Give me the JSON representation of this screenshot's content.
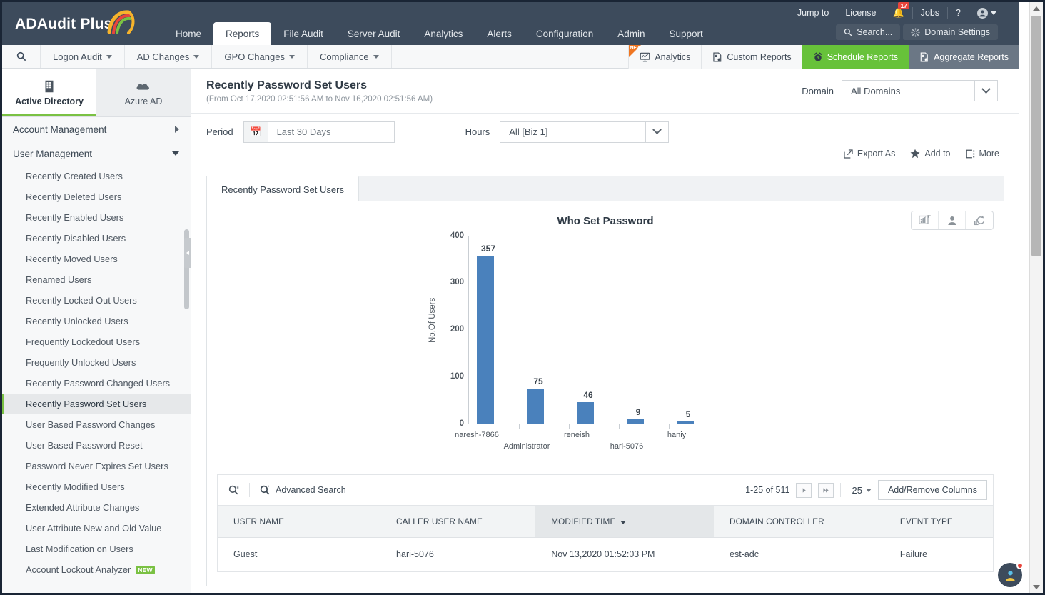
{
  "app": {
    "name": "ADAudit Plus",
    "logo_icon": "swirl-logo-icon"
  },
  "header": {
    "nav": [
      {
        "label": "Home",
        "active": false
      },
      {
        "label": "Reports",
        "active": true
      },
      {
        "label": "File Audit",
        "active": false
      },
      {
        "label": "Server Audit",
        "active": false
      },
      {
        "label": "Analytics",
        "active": false
      },
      {
        "label": "Alerts",
        "active": false
      },
      {
        "label": "Configuration",
        "active": false
      },
      {
        "label": "Admin",
        "active": false
      },
      {
        "label": "Support",
        "active": false
      }
    ],
    "utilities": [
      {
        "label": "Jump to",
        "icon": ""
      },
      {
        "label": "License",
        "icon": ""
      },
      {
        "label": "",
        "icon": "bell-icon",
        "badge": "17"
      },
      {
        "label": "Jobs",
        "icon": ""
      },
      {
        "label": "?",
        "icon": "help-icon"
      },
      {
        "label": "",
        "icon": "user-account-icon"
      }
    ],
    "search_label": "Search...",
    "search_icon": "search-icon",
    "domain_settings_label": "Domain Settings",
    "domain_settings_icon": "gear-icon"
  },
  "subnav": {
    "search_icon": "report-search-icon",
    "menus": [
      {
        "label": "Logon Audit"
      },
      {
        "label": "AD Changes"
      },
      {
        "label": "GPO Changes"
      },
      {
        "label": "Compliance"
      }
    ],
    "right": [
      {
        "label": "Analytics",
        "icon": "analytics-icon",
        "badge": "NEW",
        "style": "plain"
      },
      {
        "label": "Custom Reports",
        "icon": "custom-reports-icon",
        "style": "plain"
      },
      {
        "label": "Schedule Reports",
        "icon": "alarm-clock-icon",
        "style": "green"
      },
      {
        "label": "Aggregate Reports",
        "icon": "aggregate-reports-icon",
        "style": "grey"
      }
    ]
  },
  "sidebar": {
    "directory_tabs": [
      {
        "label": "Active Directory",
        "icon": "building-icon",
        "active": true
      },
      {
        "label": "Azure AD",
        "icon": "cloud-icon",
        "active": false
      }
    ],
    "groups": [
      {
        "label": "Account Management",
        "expanded": false
      },
      {
        "label": "User Management",
        "expanded": true
      }
    ],
    "items": [
      {
        "label": "Recently Created Users",
        "active": false
      },
      {
        "label": "Recently Deleted Users",
        "active": false
      },
      {
        "label": "Recently Enabled Users",
        "active": false
      },
      {
        "label": "Recently Disabled Users",
        "active": false
      },
      {
        "label": "Recently Moved Users",
        "active": false
      },
      {
        "label": "Renamed Users",
        "active": false
      },
      {
        "label": "Recently Locked Out Users",
        "active": false
      },
      {
        "label": "Recently Unlocked Users",
        "active": false
      },
      {
        "label": "Frequently Lockedout Users",
        "active": false
      },
      {
        "label": "Frequently Unlocked Users",
        "active": false
      },
      {
        "label": "Recently Password Changed Users",
        "active": false
      },
      {
        "label": "Recently Password Set Users",
        "active": true
      },
      {
        "label": "User Based Password Changes",
        "active": false
      },
      {
        "label": "User Based Password Reset",
        "active": false
      },
      {
        "label": "Password Never Expires Set Users",
        "active": false
      },
      {
        "label": "Recently Modified Users",
        "active": false
      },
      {
        "label": "Extended Attribute Changes",
        "active": false
      },
      {
        "label": "User Attribute New and Old Value",
        "active": false
      },
      {
        "label": "Last Modification on Users",
        "active": false
      },
      {
        "label": "Account Lockout Analyzer",
        "active": false,
        "tag": "NEW"
      }
    ]
  },
  "report": {
    "title": "Recently Password Set Users",
    "date_range": "(From Oct 17,2020 02:51:56 AM to Nov 16,2020 02:51:56 AM)",
    "domain_label": "Domain",
    "domain_value": "All Domains",
    "period_label": "Period",
    "period_value": "Last 30 Days",
    "period_icon": "calendar-icon",
    "hours_label": "Hours",
    "hours_value": "All [Biz 1]",
    "actions": [
      {
        "label": "Export As",
        "icon": "export-icon"
      },
      {
        "label": "Add to",
        "icon": "star-icon"
      },
      {
        "label": "More",
        "icon": "more-icon"
      }
    ],
    "tab_label": "Recently Password Set Users",
    "chart_tools": [
      {
        "icon": "add-chart-icon"
      },
      {
        "icon": "user-silhouette-icon"
      },
      {
        "icon": "refresh-chart-icon"
      }
    ]
  },
  "chart_data": {
    "type": "bar",
    "title": "Who Set Password",
    "xlabel": "",
    "ylabel": "No.Of Users",
    "categories": [
      "naresh-7866",
      "Administrator",
      "reneish",
      "hari-5076",
      "haniy"
    ],
    "values": [
      357,
      75,
      46,
      9,
      5
    ],
    "ylim": [
      0,
      400
    ],
    "yticks": [
      0,
      100,
      200,
      300,
      400
    ],
    "grid": false,
    "legend": "none",
    "series_color": "#4a81bc"
  },
  "table": {
    "search_icon": "search-icon",
    "advanced_search_label": "Advanced Search",
    "advanced_search_icon": "advanced-search-icon",
    "pagination_text": "1-25 of 511",
    "next_icon": "next-page-icon",
    "last_icon": "last-page-icon",
    "page_size": "25",
    "add_remove_columns_label": "Add/Remove Columns",
    "columns": [
      {
        "label": "USER NAME",
        "sorted": false
      },
      {
        "label": "CALLER USER NAME",
        "sorted": false
      },
      {
        "label": "MODIFIED TIME",
        "sorted": true
      },
      {
        "label": "DOMAIN CONTROLLER",
        "sorted": false
      },
      {
        "label": "EVENT TYPE",
        "sorted": false
      }
    ],
    "rows": [
      {
        "user_name": "Guest",
        "caller_user_name": "hari-5076",
        "modified_time": "Nov 13,2020 01:52:03 PM",
        "domain_controller": "est-adc",
        "event_type": "Failure"
      }
    ]
  },
  "chat": {
    "icon": "support-chat-avatar-icon",
    "has_notification": true
  },
  "colors": {
    "header_bg": "#3d4b5c",
    "accent_green": "#7ac143",
    "bar_blue": "#4a81bc",
    "alert_red": "#e8453c",
    "new_orange": "#ef7622"
  }
}
